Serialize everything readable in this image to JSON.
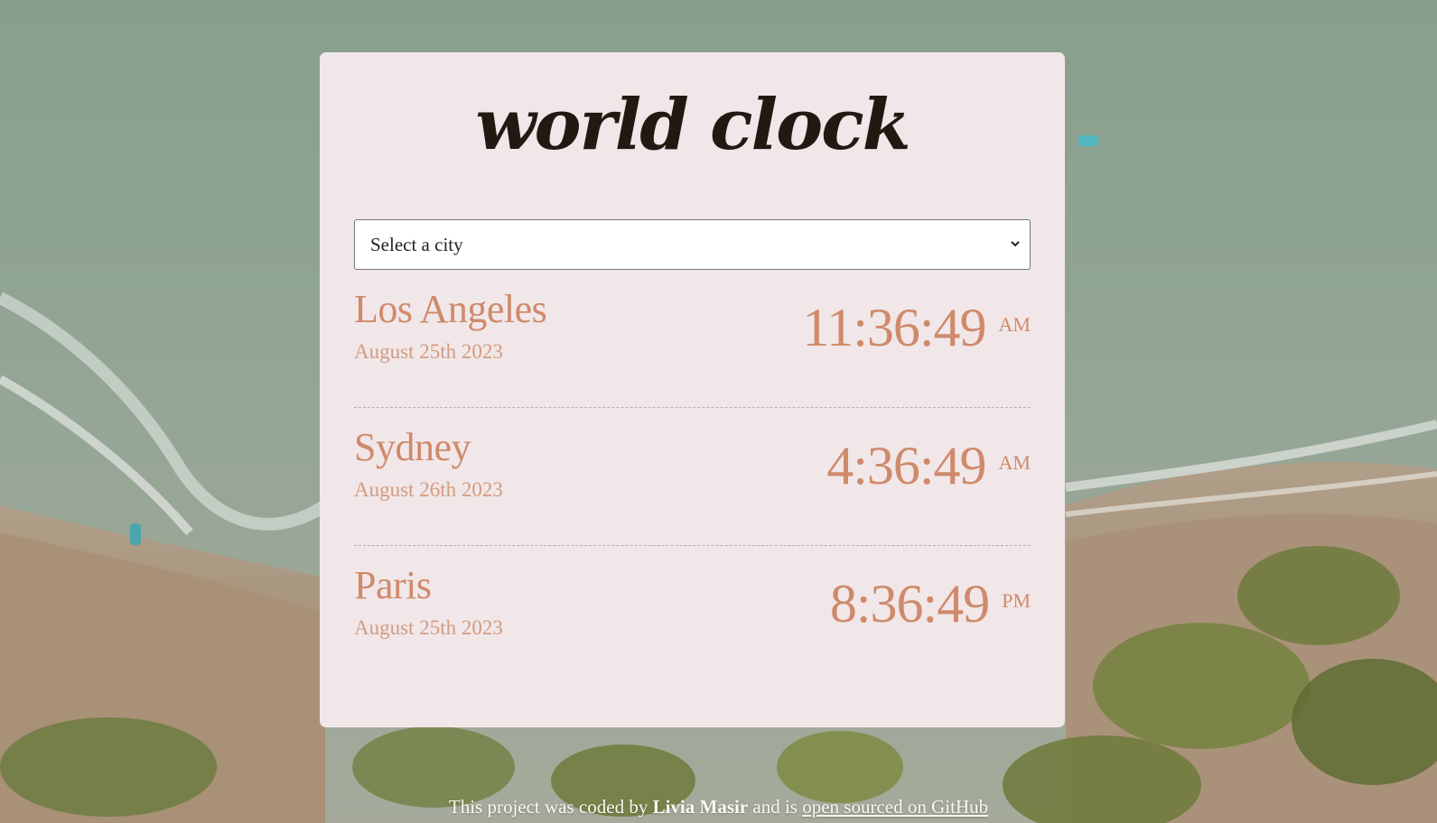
{
  "app": {
    "title": "world clock"
  },
  "city_select": {
    "value": "Select a city"
  },
  "cities": [
    {
      "name": "Los Angeles",
      "date": "August 25th 2023",
      "time": "11:36:49",
      "ampm": "AM"
    },
    {
      "name": "Sydney",
      "date": "August 26th 2023",
      "time": "4:36:49",
      "ampm": "AM"
    },
    {
      "name": "Paris",
      "date": "August 25th 2023",
      "time": "8:36:49",
      "ampm": "PM"
    }
  ],
  "footer": {
    "prefix": "This project was coded by",
    "author": "Livia Masir",
    "middle": "and is",
    "link_text": "open sourced on GitHub"
  },
  "colors": {
    "card_bg": "#f1e7e8",
    "title": "#221a12",
    "accent": "#cf8a6c",
    "date": "#d29b81"
  },
  "icons": {
    "select_caret": "chevron-down-icon"
  }
}
